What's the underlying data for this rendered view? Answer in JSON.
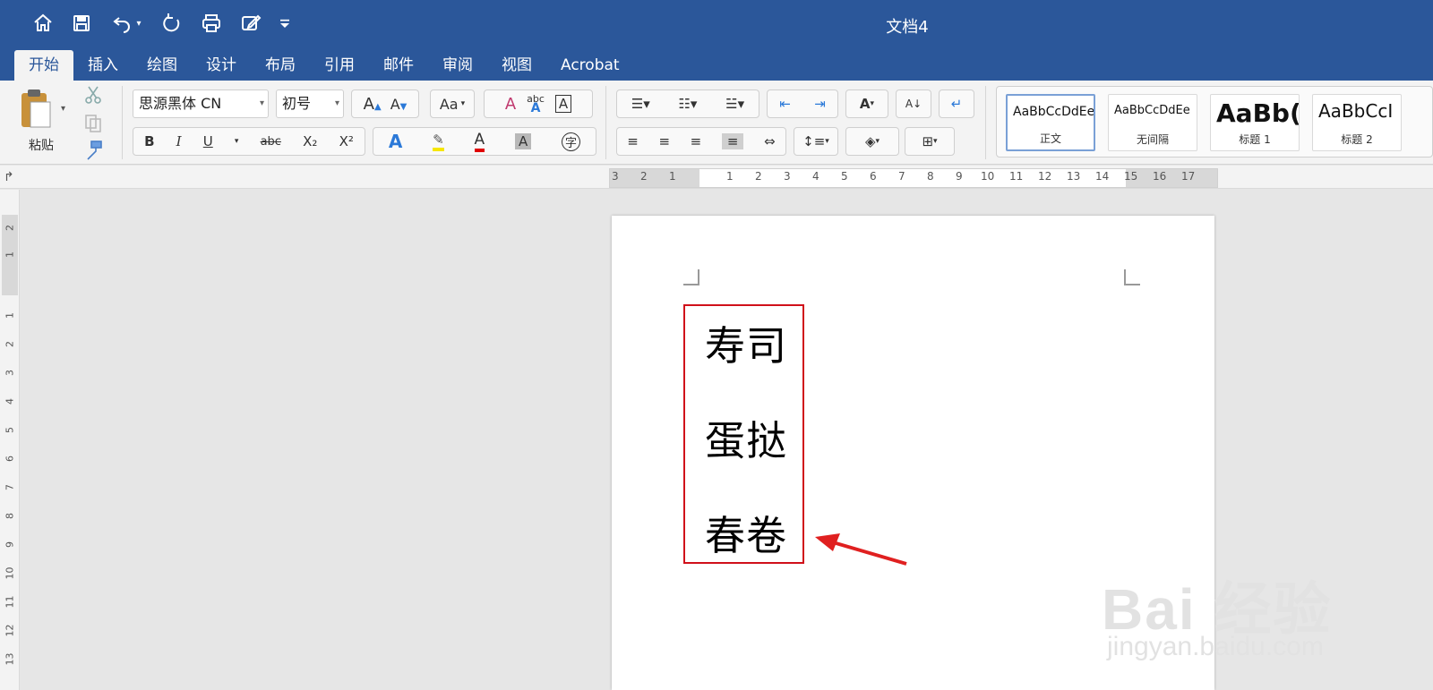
{
  "window": {
    "title": "文档4"
  },
  "quick_access": {
    "icons": [
      "home-icon",
      "save-icon",
      "undo-icon",
      "redo-icon",
      "print-icon",
      "edit-icon",
      "customize-icon"
    ]
  },
  "tabs": [
    "开始",
    "插入",
    "绘图",
    "设计",
    "布局",
    "引用",
    "邮件",
    "审阅",
    "视图",
    "Acrobat"
  ],
  "active_tab": "开始",
  "ribbon": {
    "paste_label": "粘贴",
    "font_name": "思源黑体 CN",
    "font_size": "初号",
    "styles": [
      {
        "sample": "AaBbCcDdEe",
        "name": "正文"
      },
      {
        "sample": "AaBbCcDdEe",
        "name": "无间隔"
      },
      {
        "sample": "AaBb(",
        "name": "标题 1"
      },
      {
        "sample": "AaBbCcI",
        "name": "标题 2"
      }
    ],
    "format_buttons": {
      "bold": "B",
      "italic": "I",
      "underline": "U",
      "strike": "abc",
      "subscript": "X₂",
      "superscript": "X²",
      "char_shade": "A",
      "enclose": "字"
    }
  },
  "ruler": {
    "h_numbers": [
      "3",
      "2",
      "1",
      "1",
      "2",
      "3",
      "4",
      "5",
      "6",
      "7",
      "8",
      "9",
      "10",
      "11",
      "12",
      "13",
      "14",
      "15",
      "16",
      "17"
    ],
    "v_numbers": [
      "2",
      "1",
      "1",
      "2",
      "3",
      "4",
      "5",
      "6",
      "7",
      "8",
      "9",
      "10",
      "11",
      "12",
      "13"
    ]
  },
  "document": {
    "lines": [
      "寿司",
      "蛋挞",
      "春卷"
    ]
  },
  "watermark": {
    "main": "Bai 经验",
    "sub": "jingyan.baidu.com"
  },
  "colors": {
    "titlebar": "#2b579a",
    "highlight_box": "#d0101a",
    "arrow": "#e02020"
  }
}
